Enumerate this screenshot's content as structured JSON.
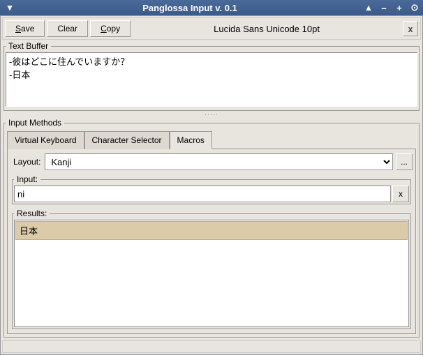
{
  "titlebar": {
    "title": "Panglossa Input v. 0.1"
  },
  "toolbar": {
    "save_label": "ave",
    "save_mnemonic": "S",
    "clear_label": "Clear",
    "copy_label": "opy",
    "copy_mnemonic": "C",
    "font_label": "Lucida Sans Unicode 10pt",
    "close_label": "x"
  },
  "text_buffer": {
    "legend": "Text Buffer",
    "content": "-彼はどこに住んでいますか？\n-日本"
  },
  "input_methods": {
    "legend": "Input Methods",
    "tabs": [
      {
        "label": "Virtual Keyboard",
        "active": false
      },
      {
        "label": "Character Selector",
        "active": false
      },
      {
        "label": "Macros",
        "active": true
      }
    ],
    "layout": {
      "label": "Layout:",
      "selected": "Kanji",
      "browse_label": "..."
    },
    "input": {
      "legend": "Input:",
      "value": "ni",
      "clear_label": "x"
    },
    "results": {
      "legend": "Results:",
      "items": [
        "日本"
      ]
    }
  }
}
